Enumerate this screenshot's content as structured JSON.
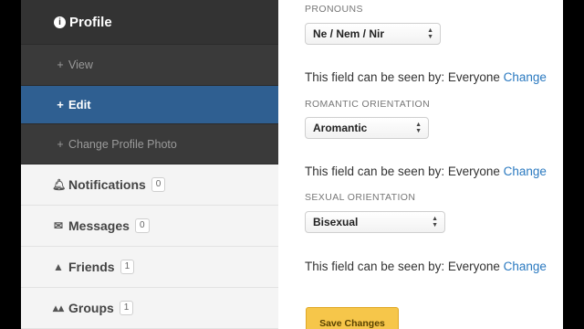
{
  "sidebar": {
    "profile_label": "Profile",
    "sub_items": [
      {
        "label": "View"
      },
      {
        "label": "Edit"
      },
      {
        "label": "Change Profile Photo"
      }
    ],
    "nav": [
      {
        "label": "Notifications",
        "count": "0",
        "icon": "bell-icon"
      },
      {
        "label": "Messages",
        "count": "0",
        "icon": "envelope-icon"
      },
      {
        "label": "Friends",
        "count": "1",
        "icon": "user-icon"
      },
      {
        "label": "Groups",
        "count": "1",
        "icon": "users-icon"
      }
    ]
  },
  "form": {
    "pronouns": {
      "label": "PRONOUNS",
      "value": "Ne / Nem / Nir"
    },
    "romantic": {
      "label": "ROMANTIC ORIENTATION",
      "value": "Aromantic"
    },
    "sexual": {
      "label": "SEXUAL ORIENTATION",
      "value": "Bisexual"
    },
    "visibility_text": "This field can be seen by: Everyone",
    "change_link": "Change",
    "save_label": "Save Changes"
  },
  "colors": {
    "active": "#2f5f91",
    "link": "#2a79c0",
    "save": "#f6c64a"
  }
}
